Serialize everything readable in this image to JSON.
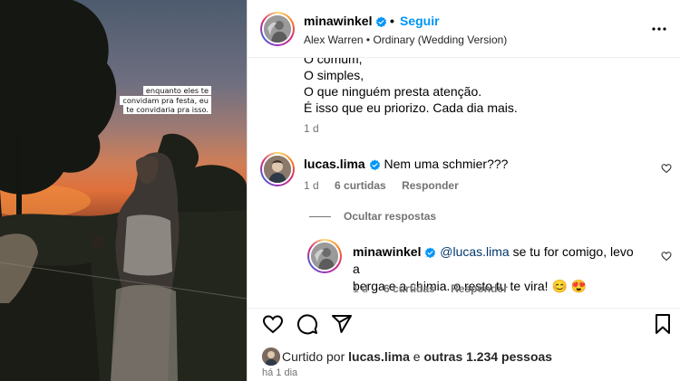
{
  "photo": {
    "caption_lines": [
      "enquanto eles te",
      "convidam pra festa, eu",
      "te convidaria pra isso."
    ]
  },
  "header": {
    "username": "minawinkel",
    "separator": "•",
    "follow_label": "Seguir",
    "song": "Alex Warren • Ordinary (Wedding Version)"
  },
  "caption": {
    "lines": [
      "O comum,",
      "O simples,",
      "O que ninguém presta atenção.",
      "É isso que eu priorizo. Cada dia mais."
    ],
    "time": "1 d"
  },
  "comment": {
    "username": "lucas.lima",
    "text": "Nem uma schmier???",
    "time": "1 d",
    "likes": "6 curtidas",
    "reply_label": "Responder"
  },
  "hide_replies_label": "Ocultar respostas",
  "reply": {
    "username": "minawinkel",
    "mention": "@lucas.lima",
    "text_line1": " se tu for comigo, levo a",
    "text_line2": "berga e a chimia. o resto tu te vira! 😊 😍",
    "time": "1 d",
    "likes": "6 curtidas",
    "reply_label": "Responder"
  },
  "likes": {
    "prefix": "Curtido por",
    "user": "lucas.lima",
    "middle": "e",
    "others": "outras 1.234 pessoas"
  },
  "post_time": "há 1 dia",
  "colors": {
    "link_blue": "#0095f6",
    "verified_blue": "#0095f6",
    "muted_gray": "#737373",
    "mention_blue": "#00376b"
  }
}
